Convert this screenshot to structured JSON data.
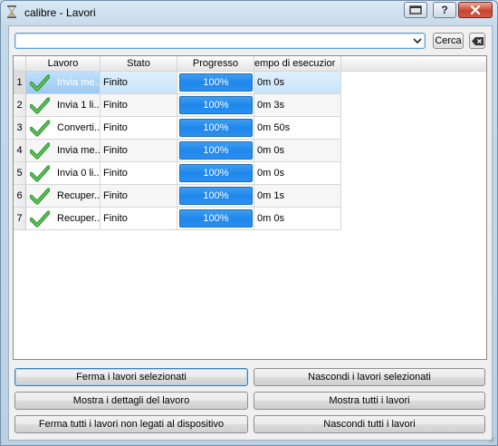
{
  "window": {
    "title": "calibre - Lavori"
  },
  "search": {
    "value": "",
    "placeholder": "",
    "button_label": "Cerca"
  },
  "table": {
    "headers": [
      "Lavoro",
      "Stato",
      "Progresso",
      "empo di esecuzior"
    ],
    "rows": [
      {
        "num": "1",
        "lavoro": "Invia me...",
        "stato": "Finito",
        "progresso": "100%",
        "progress_value": 1.0,
        "tempo": "0m 0s",
        "selected": true
      },
      {
        "num": "2",
        "lavoro": "Invia 1 li...",
        "stato": "Finito",
        "progresso": "100%",
        "progress_value": 1.0,
        "tempo": "0m 3s"
      },
      {
        "num": "3",
        "lavoro": "Converti...",
        "stato": "Finito",
        "progresso": "100%",
        "progress_value": 1.0,
        "tempo": "0m 50s"
      },
      {
        "num": "4",
        "lavoro": "Invia me...",
        "stato": "Finito",
        "progresso": "100%",
        "progress_value": 1.0,
        "tempo": "0m 0s"
      },
      {
        "num": "5",
        "lavoro": "Invia 0 li...",
        "stato": "Finito",
        "progresso": "100%",
        "progress_value": 1.0,
        "tempo": "0m 0s"
      },
      {
        "num": "6",
        "lavoro": "Recuper...",
        "stato": "Finito",
        "progresso": "100%",
        "progress_value": 1.0,
        "tempo": "0m 1s"
      },
      {
        "num": "7",
        "lavoro": "Recuper...",
        "stato": "Finito",
        "progresso": "100%",
        "progress_value": 1.0,
        "tempo": "0m 0s"
      }
    ]
  },
  "buttons": {
    "stop_selected": "Ferma i lavori selezionati",
    "hide_selected": "Nascondi i lavori selezionati",
    "show_details": "Mostra i dettagli del lavoro",
    "show_all": "Mostra tutti i lavori",
    "stop_all_non_device": "Ferma tutti i lavori non legati al dispositivo",
    "hide_all": "Nascondi tutti i lavori"
  },
  "colors": {
    "progress": "#1f86ec",
    "check": "#3aa43a",
    "selection": "#9ccaf1"
  },
  "icons": [
    "hourglass-icon",
    "maximize-icon",
    "help-icon",
    "close-icon",
    "dropdown-arrow-icon",
    "clear-icon",
    "checkmark-icon"
  ]
}
